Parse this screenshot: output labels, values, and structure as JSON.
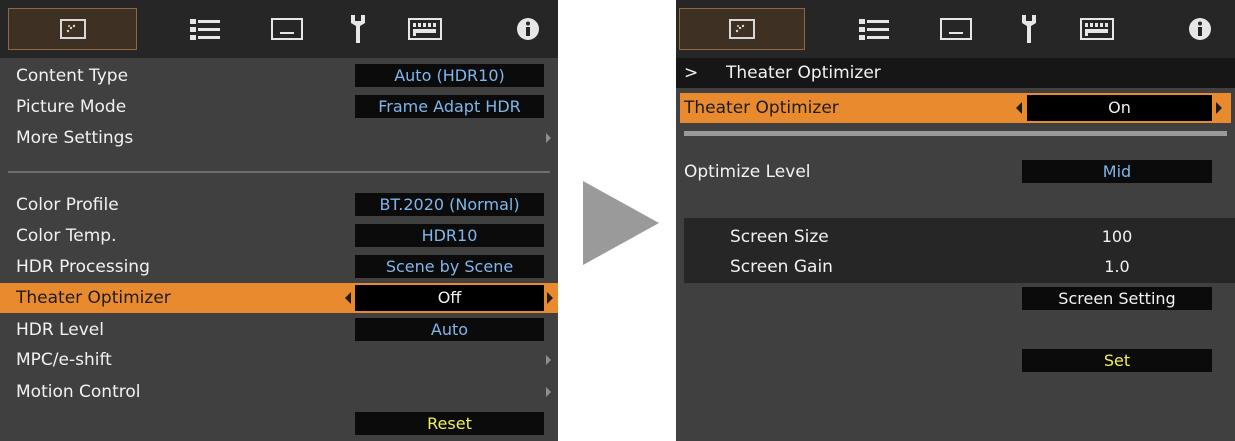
{
  "left_menu": {
    "tabs": [
      "picture-icon",
      "settings-sliders-icon",
      "input-display-icon",
      "wrench-icon",
      "keyboard-icon",
      "info-icon"
    ],
    "items": {
      "content_type": {
        "label": "Content Type",
        "value": "Auto (HDR10)"
      },
      "picture_mode": {
        "label": "Picture Mode",
        "value": "Frame Adapt HDR"
      },
      "more_settings": {
        "label": "More Settings"
      },
      "color_profile": {
        "label": "Color Profile",
        "value": "BT.2020 (Normal)"
      },
      "color_temp": {
        "label": "Color Temp.",
        "value": "HDR10"
      },
      "hdr_processing": {
        "label": "HDR Processing",
        "value": "Scene by Scene"
      },
      "theater_optimizer": {
        "label": "Theater Optimizer",
        "value": "Off"
      },
      "hdr_level": {
        "label": "HDR Level",
        "value": "Auto"
      },
      "mpc_eshift": {
        "label": "MPC/e-shift"
      },
      "motion_control": {
        "label": "Motion Control"
      }
    },
    "reset_label": "Reset"
  },
  "right_menu": {
    "tabs": [
      "picture-icon",
      "settings-sliders-icon",
      "input-display-icon",
      "wrench-icon",
      "keyboard-icon",
      "info-icon"
    ],
    "breadcrumb_marker": ">",
    "breadcrumb_title": "Theater Optimizer",
    "theater_optimizer": {
      "label": "Theater Optimizer",
      "value": "On"
    },
    "optimize_level": {
      "label": "Optimize Level",
      "value": "Mid"
    },
    "screen_size": {
      "label": "Screen Size",
      "value": "100"
    },
    "screen_gain": {
      "label": "Screen Gain",
      "value": "1.0"
    },
    "screen_setting_label": "Screen Setting",
    "set_label": "Set"
  },
  "colors": {
    "panel_bg": "#404040",
    "tab_bar_bg": "#262626",
    "highlight_orange": "#ea8a2f",
    "value_blue": "#7fb6ec",
    "value_yellow": "#f3ef5c",
    "arrow_gray": "#9a9a9a"
  }
}
